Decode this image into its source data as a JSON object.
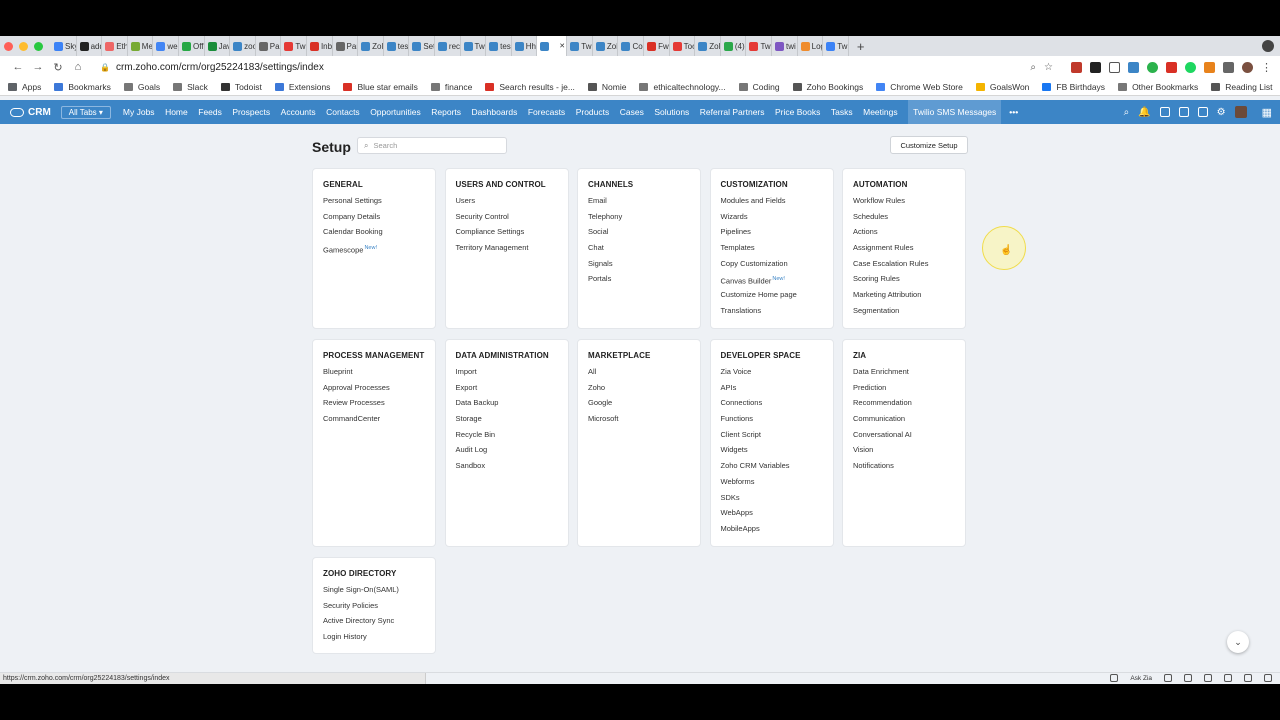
{
  "browser": {
    "tabs": [
      "Sky",
      "add",
      "Eth",
      "Me",
      "we",
      "Off",
      "Jav",
      "zoo",
      "Par",
      "Twi",
      "Inb",
      "Par",
      "Zol",
      "tes",
      "Set",
      "rec",
      "Twi",
      "tes",
      "Hh",
      "",
      "Twi",
      "Zol",
      "Co",
      "Fw",
      "Too",
      "Zol",
      "(4)",
      "Twi",
      "twi",
      "Log",
      "Twi"
    ],
    "tab_colors": [
      "#3b82f6",
      "#222222",
      "#e66",
      "#7a3",
      "#4285f4",
      "#27a845",
      "#1a8d3a",
      "#3c85c6",
      "#666",
      "#e53935",
      "#d93025",
      "#666",
      "#3c85c6",
      "#3c85c6",
      "#3c85c6",
      "#3c85c6",
      "#3c85c6",
      "#3c85c6",
      "#3c85c6",
      "#3c85c6",
      "#3c85c6",
      "#3c85c6",
      "#3c85c6",
      "#d93025",
      "#e53935",
      "#3c85c6",
      "#2ba84a",
      "#e53935",
      "#7e57c2",
      "#ef8c2d",
      "#3b82f6"
    ],
    "active_tab_index": 19,
    "new_tab_label": "+",
    "url": "crm.zoho.com/crm/org25224183/settings/index",
    "bookmarks": [
      {
        "label": "Apps",
        "color": "#5f6368"
      },
      {
        "label": "Bookmarks",
        "color": "#3c78d8"
      },
      {
        "label": "Goals",
        "color": "#777"
      },
      {
        "label": "Slack",
        "color": "#777"
      },
      {
        "label": "Todoist",
        "color": "#333"
      },
      {
        "label": "Extensions",
        "color": "#3c78d8"
      },
      {
        "label": "Blue star emails",
        "color": "#d93025"
      },
      {
        "label": "finance",
        "color": "#777"
      },
      {
        "label": "Search results - je...",
        "color": "#d93025"
      },
      {
        "label": "Nomie",
        "color": "#555"
      },
      {
        "label": "ethicaltechnology...",
        "color": "#777"
      },
      {
        "label": "Coding",
        "color": "#777"
      },
      {
        "label": "Zoho Bookings",
        "color": "#555"
      },
      {
        "label": "Chrome Web Store",
        "color": "#4285f4"
      },
      {
        "label": "GoalsWon",
        "color": "#f4b400"
      },
      {
        "label": "FB Birthdays",
        "color": "#1877f2"
      }
    ],
    "bookmarks_right": [
      {
        "label": "Other Bookmarks",
        "color": "#777"
      },
      {
        "label": "Reading List",
        "color": "#555"
      }
    ],
    "status_url": "https://crm.zoho.com/crm/org25224183/settings/index"
  },
  "crm": {
    "logo": "CRM",
    "all_tabs": "All Tabs",
    "nav_items": [
      "My Jobs",
      "Home",
      "Feeds",
      "Prospects",
      "Accounts",
      "Contacts",
      "Opportunities",
      "Reports",
      "Dashboards",
      "Forecasts",
      "Products",
      "Cases",
      "Solutions",
      "Referral Partners",
      "Price Books",
      "Tasks",
      "Meetings",
      "Twilio SMS Messages"
    ],
    "nav_more": "•••",
    "ask_zia": "Ask Zia"
  },
  "setup": {
    "title": "Setup",
    "search_placeholder": "Search",
    "customize_button": "Customize Setup",
    "new_badge": "New!",
    "sections": [
      {
        "title": "GENERAL",
        "items": [
          "Personal Settings",
          "Company Details",
          "Calendar Booking",
          "Gamescope"
        ],
        "new": [
          3
        ]
      },
      {
        "title": "USERS AND CONTROL",
        "items": [
          "Users",
          "Security Control",
          "Compliance Settings",
          "Territory Management"
        ],
        "new": []
      },
      {
        "title": "CHANNELS",
        "items": [
          "Email",
          "Telephony",
          "Social",
          "Chat",
          "Signals",
          "Portals"
        ],
        "new": []
      },
      {
        "title": "CUSTOMIZATION",
        "items": [
          "Modules and Fields",
          "Wizards",
          "Pipelines",
          "Templates",
          "Copy Customization",
          "Canvas Builder",
          "Customize Home page",
          "Translations"
        ],
        "new": [
          5
        ]
      },
      {
        "title": "AUTOMATION",
        "items": [
          "Workflow Rules",
          "Schedules",
          "Actions",
          "Assignment Rules",
          "Case Escalation Rules",
          "Scoring Rules",
          "Marketing Attribution",
          "Segmentation"
        ],
        "new": []
      },
      {
        "title": "PROCESS MANAGEMENT",
        "items": [
          "Blueprint",
          "Approval Processes",
          "Review Processes",
          "CommandCenter"
        ],
        "new": []
      },
      {
        "title": "DATA ADMINISTRATION",
        "items": [
          "Import",
          "Export",
          "Data Backup",
          "Storage",
          "Recycle Bin",
          "Audit Log",
          "Sandbox"
        ],
        "new": []
      },
      {
        "title": "MARKETPLACE",
        "items": [
          "All",
          "Zoho",
          "Google",
          "Microsoft"
        ],
        "new": []
      },
      {
        "title": "DEVELOPER SPACE",
        "items": [
          "Zia Voice",
          "APIs",
          "Connections",
          "Functions",
          "Client Script",
          "Widgets",
          "Zoho CRM Variables",
          "Webforms",
          "SDKs",
          "WebApps",
          "MobileApps"
        ],
        "new": []
      },
      {
        "title": "ZIA",
        "items": [
          "Data Enrichment",
          "Prediction",
          "Recommendation",
          "Communication",
          "Conversational AI",
          "Vision",
          "Notifications"
        ],
        "new": []
      },
      {
        "title": "ZOHO DIRECTORY",
        "items": [
          "Single Sign-On(SAML)",
          "Security Policies",
          "Active Directory Sync",
          "Login History"
        ],
        "new": []
      }
    ]
  },
  "colors": {
    "nav_blue": "#3c85c6",
    "page_bg": "#eef1f5"
  }
}
